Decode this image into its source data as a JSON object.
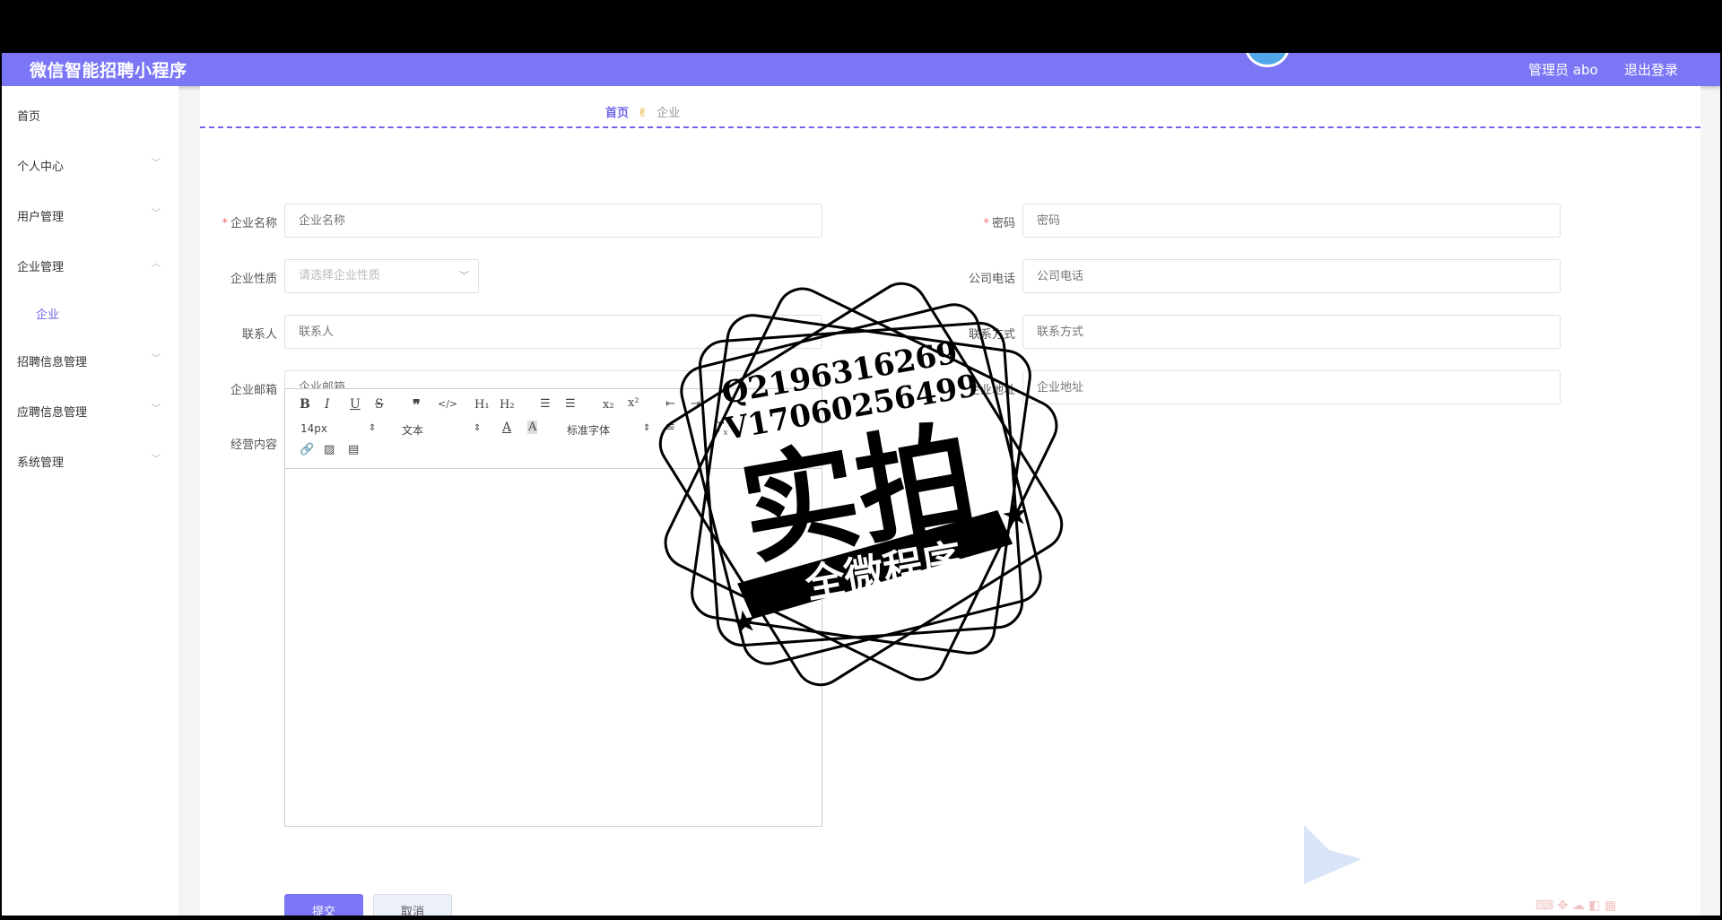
{
  "header": {
    "app_title": "微信智能招聘小程序",
    "admin_label": "管理员 abo",
    "logout_label": "退出登录",
    "bar_color": "#7b76f5"
  },
  "sidebar": {
    "items": [
      {
        "label": "首页"
      },
      {
        "label": "个人中心"
      },
      {
        "label": "用户管理"
      },
      {
        "label": "企业管理",
        "expanded": true
      },
      {
        "label": "招聘信息管理"
      },
      {
        "label": "应聘信息管理"
      },
      {
        "label": "系统管理"
      }
    ],
    "sub_item": {
      "label": "企业"
    }
  },
  "breadcrumb": {
    "home": "首页",
    "current": "企业"
  },
  "form": {
    "company_name": {
      "label": "企业名称",
      "placeholder": "企业名称",
      "required": true
    },
    "password": {
      "label": "密码",
      "placeholder": "密码",
      "required": true
    },
    "company_type": {
      "label": "企业性质",
      "placeholder": "请选择企业性质"
    },
    "company_phone": {
      "label": "公司电话",
      "placeholder": "公司电话"
    },
    "contact_person": {
      "label": "联系人",
      "placeholder": "联系人"
    },
    "contact_info": {
      "label": "联系方式",
      "placeholder": "联系方式"
    },
    "company_email": {
      "label": "企业邮箱",
      "placeholder": "企业邮箱"
    },
    "company_address": {
      "label": "企业地址",
      "placeholder": "企业地址"
    },
    "business_content": {
      "label": "经营内容"
    }
  },
  "editor": {
    "font_size": "14px",
    "paragraph": "文本",
    "font_family": "标准字体",
    "icons": [
      "bold-icon",
      "italic-icon",
      "underline-icon",
      "strike-icon",
      "quote-icon",
      "code-icon",
      "h1-icon",
      "h2-icon",
      "ordered-list-icon",
      "bullet-list-icon",
      "subscript-icon",
      "superscript-icon",
      "outdent-icon",
      "indent-icon",
      "font-color-icon",
      "background-color-icon",
      "align-icon",
      "clear-format-icon",
      "link-icon",
      "image-icon",
      "video-icon"
    ]
  },
  "buttons": {
    "submit": "提交",
    "cancel": "取消"
  },
  "stamp": {
    "line1": "Q2196316269",
    "line2": "V17060256499",
    "main": "实拍",
    "banner": "全微程序"
  },
  "required_mark": "*"
}
